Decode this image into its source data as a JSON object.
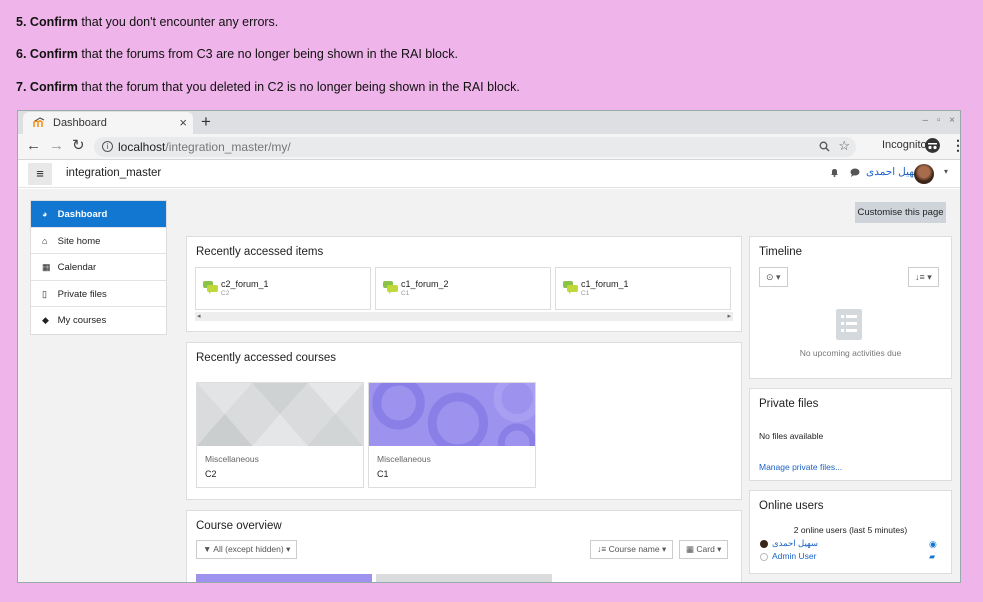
{
  "instructions": [
    {
      "num": "5.",
      "verb": "Confirm",
      "rest": "that you don't encounter any errors."
    },
    {
      "num": "6.",
      "verb": "Confirm",
      "rest": "that the forums from C3 are no longer being shown in the RAI block."
    },
    {
      "num": "7.",
      "verb": "Confirm",
      "rest": "that the forum that you deleted in C2 is no longer being shown in the RAI block."
    }
  ],
  "browser": {
    "tab_title": "Dashboard",
    "tab_close": "×",
    "new_tab": "+",
    "window_controls": "– ▫ ×",
    "url_host": "localhost",
    "url_path": "/integration_master/my/",
    "incognito_label": "Incognito"
  },
  "navbar": {
    "menu_icon": "≡",
    "site_name": "integration_master",
    "user_name": "سهیل احمدی",
    "caret": "▾"
  },
  "sidebar": {
    "items": [
      {
        "label": "Dashboard",
        "icon": "dashboard-icon",
        "glyph": "◕",
        "active": true
      },
      {
        "label": "Site home",
        "icon": "home-icon",
        "glyph": "⌂",
        "active": false
      },
      {
        "label": "Calendar",
        "icon": "calendar-icon",
        "glyph": "▦",
        "active": false
      },
      {
        "label": "Private files",
        "icon": "file-icon",
        "glyph": "▯",
        "active": false
      },
      {
        "label": "My courses",
        "icon": "graduation-cap-icon",
        "glyph": "◆",
        "active": false
      }
    ]
  },
  "customise_button": "Customise this page",
  "recent_items": {
    "title": "Recently accessed items",
    "items": [
      {
        "name": "c2_forum_1",
        "course": "C2"
      },
      {
        "name": "c1_forum_2",
        "course": "C1"
      },
      {
        "name": "c1_forum_1",
        "course": "C1"
      }
    ],
    "scroll_left": "◂",
    "scroll_right": "▸"
  },
  "recent_courses": {
    "title": "Recently accessed courses",
    "courses": [
      {
        "category": "Miscellaneous",
        "name": "C2"
      },
      {
        "category": "Miscellaneous",
        "name": "C1"
      }
    ]
  },
  "course_overview": {
    "title": "Course overview",
    "filter_label": "▼ All (except hidden) ▾",
    "sort_label": "↓≡ Course name ▾",
    "view_label": "▦ Card ▾"
  },
  "timeline": {
    "title": "Timeline",
    "filter_btn": "⊙ ▾",
    "sort_btn": "↓≡ ▾",
    "empty_text": "No upcoming activities due"
  },
  "private_files": {
    "title": "Private files",
    "empty_text": "No files available",
    "manage_link": "Manage private files..."
  },
  "online_users": {
    "title": "Online users",
    "summary": "2 online users (last 5 minutes)",
    "users": [
      {
        "name": "سهیل احمدی",
        "action_icon": "eye-icon",
        "glyph": "◉"
      },
      {
        "name": "Admin User",
        "action_icon": "message-icon",
        "glyph": "▰"
      }
    ]
  }
}
